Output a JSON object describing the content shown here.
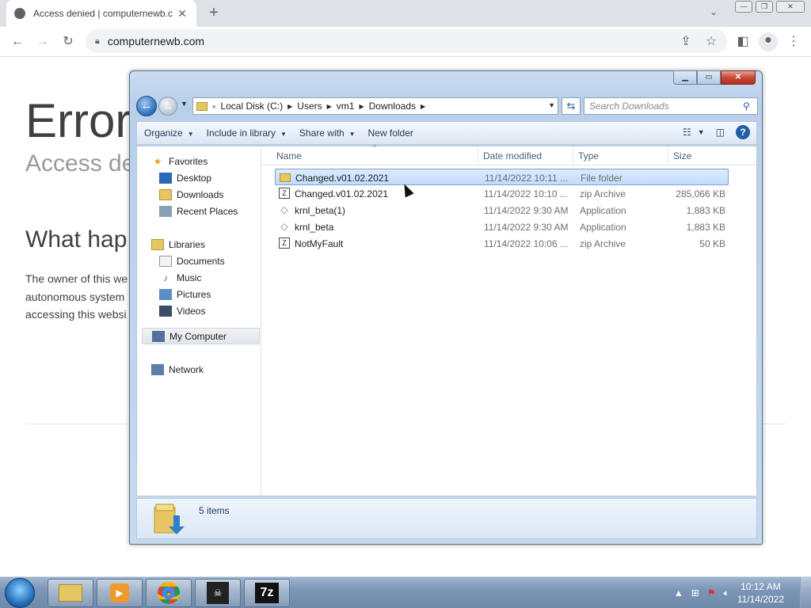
{
  "browser": {
    "tab_title": "Access denied | computernewb.c",
    "tab_close": "✕",
    "new_tab": "+",
    "url": "computernewb.com"
  },
  "webpage": {
    "heading": "Error",
    "subheading": "Access der",
    "section_title": "What hap",
    "paragraph_line1": "The owner of this we",
    "paragraph_line2": "autonomous system",
    "paragraph_line3": "accessing this websi"
  },
  "explorer": {
    "address_segments": [
      "Local Disk (C:)",
      "Users",
      "vm1",
      "Downloads"
    ],
    "search_placeholder": "Search Downloads",
    "commands": {
      "organize": "Organize",
      "include_in_library": "Include in library",
      "share_with": "Share with",
      "new_folder": "New folder"
    },
    "nav": {
      "favorites": "Favorites",
      "desktop": "Desktop",
      "downloads": "Downloads",
      "recent_places": "Recent Places",
      "libraries": "Libraries",
      "documents": "Documents",
      "music": "Music",
      "pictures": "Pictures",
      "videos": "Videos",
      "my_computer": "My Computer",
      "network": "Network"
    },
    "columns": {
      "name": "Name",
      "date": "Date modified",
      "type": "Type",
      "size": "Size"
    },
    "files": [
      {
        "name": "Changed.v01.02.2021",
        "date": "11/14/2022 10:11 ...",
        "type": "File folder",
        "size": "",
        "icon": "folder-icon"
      },
      {
        "name": "Changed.v01.02.2021",
        "date": "11/14/2022 10:10 ...",
        "type": "zip Archive",
        "size": "285,066 KB",
        "icon": "zip-icon"
      },
      {
        "name": "krnl_beta(1)",
        "date": "11/14/2022 9:30 AM",
        "type": "Application",
        "size": "1,883 KB",
        "icon": "app-icon"
      },
      {
        "name": "krnl_beta",
        "date": "11/14/2022 9:30 AM",
        "type": "Application",
        "size": "1,883 KB",
        "icon": "app-icon"
      },
      {
        "name": "NotMyFault",
        "date": "11/14/2022 10:06 ...",
        "type": "zip Archive",
        "size": "50 KB",
        "icon": "zip-icon"
      }
    ],
    "item_count": "5 items"
  },
  "taskbar": {
    "time": "10:12 AM",
    "date": "11/14/2022",
    "seven_zip_label": "7z"
  },
  "colors": {
    "accent": "#1f5fa8",
    "selection": "#c1dcfc"
  }
}
